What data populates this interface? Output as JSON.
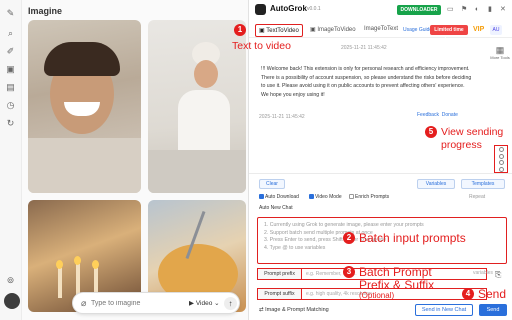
{
  "left_app": {
    "title": "Imagine",
    "prompt_placeholder": "Type to imagine",
    "mode_label": "Video"
  },
  "extension": {
    "brand": "AutoGrok",
    "version": "v0.0.1",
    "download_label": "DOWNLOADER",
    "tabs": [
      {
        "label": "TextToVideo",
        "active": true
      },
      {
        "label": "ImageToVideo",
        "active": false
      },
      {
        "label": "ImageToText",
        "active": false
      }
    ],
    "usage_guide": "Usage Guide",
    "limited_label": "Limited time free",
    "vip_label": "VIP",
    "lang_label": "AU",
    "timestamp_top": "2025-11-21 11:45:42",
    "timestamp_bottom": "2025-11-21 11:45:42",
    "welcome_message": "!!! Welcome back! This extension is only for personal research and efficiency improvement. There is a possibility of account suspension, so please understand the risks before deciding to use it. Please avoid using it on public accounts to prevent affecting others' experience. We hope you enjoy using it!",
    "feedback": "Feedback",
    "donate": "Donate",
    "more_tools": "More Tools",
    "clear_label": "Clear",
    "variables_label": "Variables",
    "templates_label": "Templates",
    "options": {
      "auto_download": "Auto Download",
      "video_mode": "Video Mode",
      "enrich_prompts": "Enrich Prompts",
      "repeat": "Repeat"
    },
    "auto_new_chat": "Auto New Chat",
    "prompt_placeholder_lines": [
      "1. Currently using Grok to generate image, please enter your prompts",
      "2. Support batch send multiple prompts at once",
      "3. Press Enter to send, press Shift+Enter to wrap line",
      "4. Type @ to use variables"
    ],
    "prefix_label": "Prompt prefix",
    "prefix_placeholder": "e.g. Remember, use ...",
    "suffix_label": "Prompt suffix",
    "suffix_placeholder": "e.g. high quality, 4k resolution",
    "variables_hint": "variables",
    "image_prompt_matching": "Image & Prompt Matching",
    "send_new_chat": "Send in New Chat",
    "send": "Send"
  },
  "callouts": [
    {
      "num": "1",
      "text": "Text to video"
    },
    {
      "num": "2",
      "text": "Batch input prompts"
    },
    {
      "num": "3",
      "text": "Batch Prompt",
      "line2": "Prefix & Suffix",
      "sub": "(Optional)"
    },
    {
      "num": "4",
      "text": "Send"
    },
    {
      "num": "5",
      "text": "View sending",
      "line2": "progress"
    }
  ],
  "colors": {
    "accent": "#2a6fdb",
    "callout": "#e41e1e",
    "download": "#17a34a",
    "limited": "#ef4444"
  },
  "icons": [
    "pencil-icon",
    "search-icon",
    "image-icon",
    "folder-icon",
    "gear-icon",
    "paperclip-icon",
    "arrow-up-icon",
    "grid-icon",
    "chat-icon"
  ]
}
